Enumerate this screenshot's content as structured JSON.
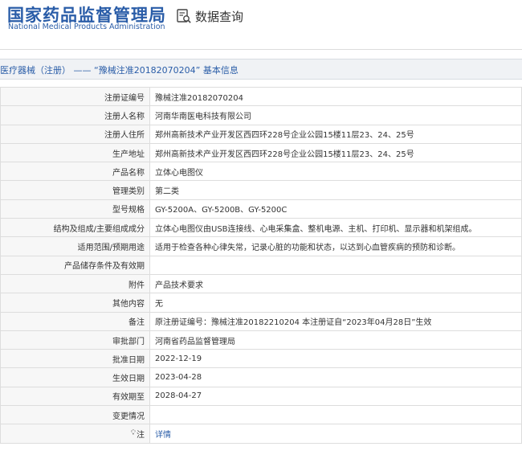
{
  "header": {
    "logo_cn": "国家药品监督管理局",
    "logo_en": "National Medical Products Administration",
    "query_label": "数据查询",
    "query_icon": "document-search-icon"
  },
  "breadcrumb": {
    "text": "医疗器械（注册） —— “豫械注准20182070204” 基本信息"
  },
  "rows": [
    {
      "label": "注册证编号",
      "value": "豫械注准20182070204"
    },
    {
      "label": "注册人名称",
      "value": "河南华南医电科技有限公司"
    },
    {
      "label": "注册人住所",
      "value": "郑州高新技术产业开发区西四环228号企业公园15楼11层23、24、25号"
    },
    {
      "label": "生产地址",
      "value": "郑州高新技术产业开发区西四环228号企业公园15楼11层23、24、25号"
    },
    {
      "label": "产品名称",
      "value": "立体心电图仪"
    },
    {
      "label": "管理类别",
      "value": "第二类"
    },
    {
      "label": "型号规格",
      "value": "GY-5200A、GY-5200B、GY-5200C"
    },
    {
      "label": "结构及组成/主要组成成分",
      "value": "立体心电图仪由USB连接线、心电采集盒、整机电源、主机、打印机、显示器和机架组成。"
    },
    {
      "label": "适用范围/预期用途",
      "value": "适用于检查各种心律失常，记录心脏的功能和状态，以达到心血管疾病的预防和诊断。"
    },
    {
      "label": "产品储存条件及有效期",
      "value": ""
    },
    {
      "label": "附件",
      "value": "产品技术要求"
    },
    {
      "label": "其他内容",
      "value": "无"
    },
    {
      "label": "备注",
      "value": "原注册证编号：豫械注准20182210204 本注册证自“2023年04月28日”生效"
    },
    {
      "label": "审批部门",
      "value": "河南省药品监督管理局"
    },
    {
      "label": "批准日期",
      "value": "2022-12-19"
    },
    {
      "label": "生效日期",
      "value": "2023-04-28"
    },
    {
      "label": "有效期至",
      "value": "2028-04-27"
    },
    {
      "label": "变更情况",
      "value": ""
    }
  ],
  "note_row": {
    "icon": "lightbulb-icon",
    "label": "注",
    "link": "详情"
  },
  "colors": {
    "brand_blue": "#2a5da8",
    "label_bg": "#f7f7f7",
    "breadcrumb_bg": "#f0f2f5",
    "border": "#dddddd"
  }
}
